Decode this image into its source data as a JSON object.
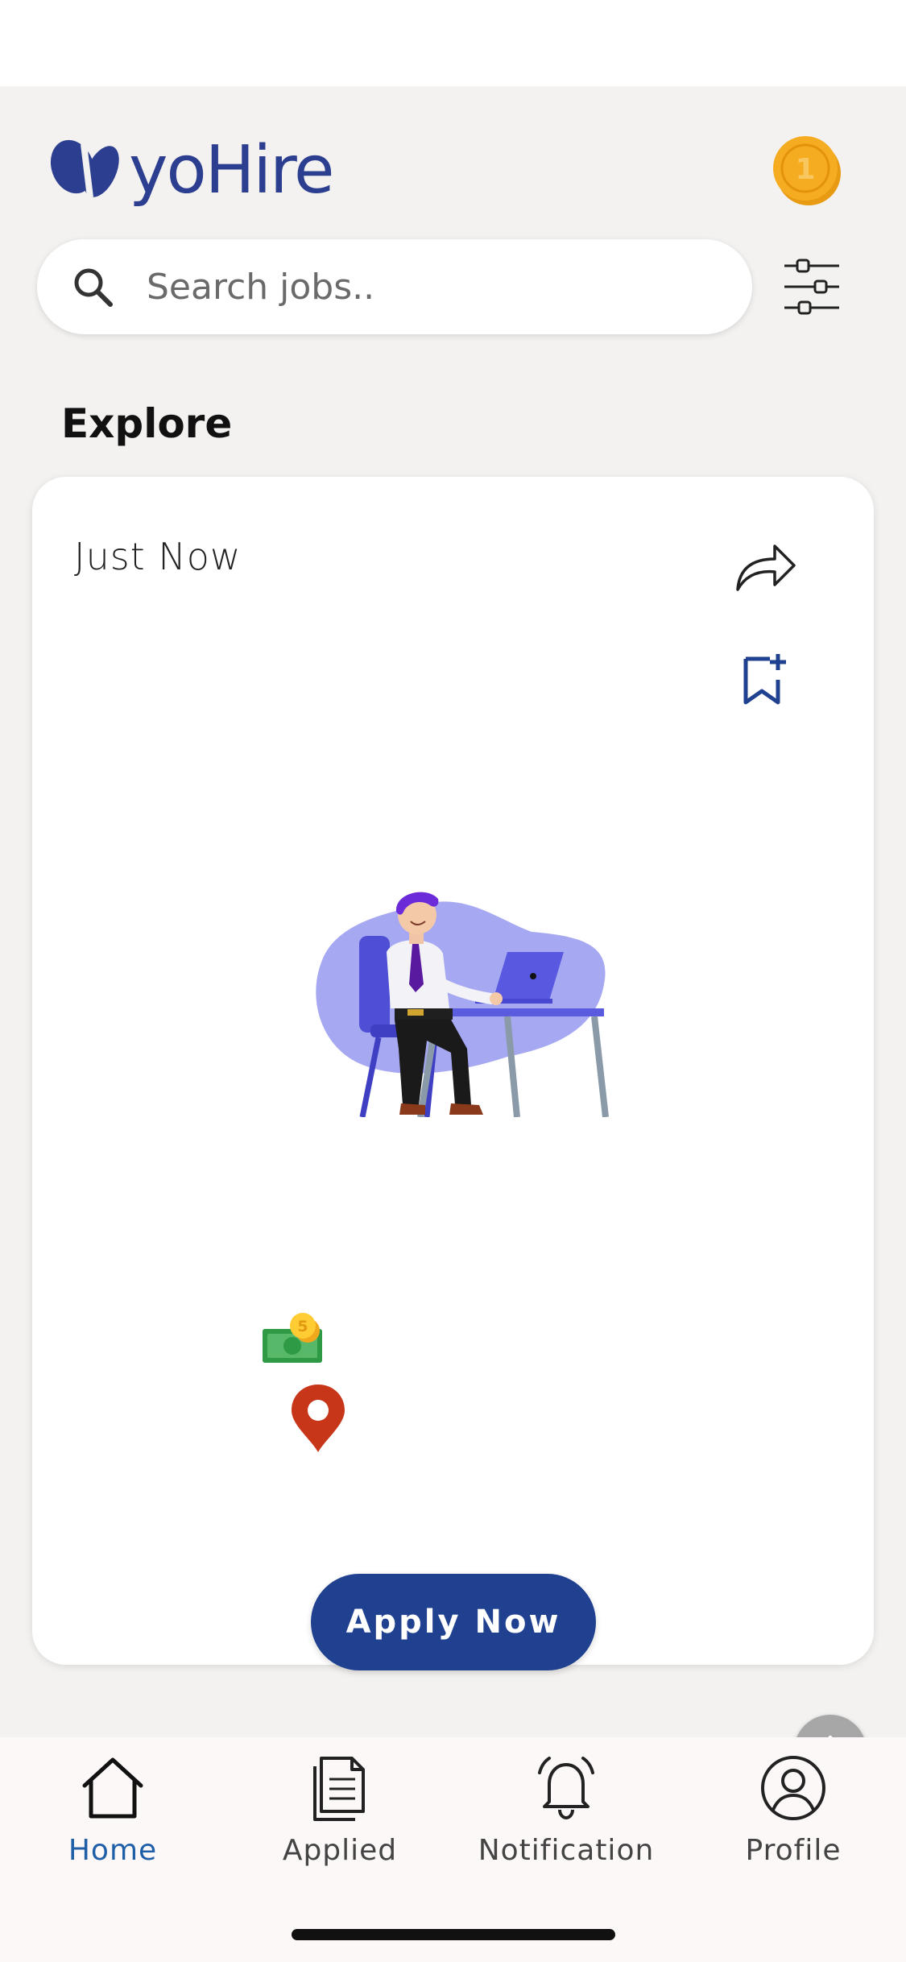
{
  "app": {
    "brand_name": "yoHire",
    "accent_color": "#1f4190",
    "logo_color": "#2c3e8f"
  },
  "header": {
    "logo_icon": "yohire-logo-icon",
    "coin_icon": "coin-icon",
    "coin_value": "1"
  },
  "search": {
    "placeholder": "Search jobs..",
    "icon": "search-icon",
    "filter_icon": "sliders-icon"
  },
  "explore": {
    "title": "Explore"
  },
  "job_card": {
    "time_label": "Just Now",
    "share_icon": "share-icon",
    "bookmark_icon": "bookmark-add-icon",
    "illustration": "office-worker-illustration",
    "salary_icon": "money-icon",
    "salary_coin_value": "5",
    "location_icon": "location-pin-icon",
    "apply_label": "Apply Now"
  },
  "scroll_top": {
    "icon": "arrow-up-icon"
  },
  "bottom_nav": {
    "items": [
      {
        "label": "Home",
        "icon": "home-icon",
        "active": true
      },
      {
        "label": "Applied",
        "icon": "document-icon",
        "active": false
      },
      {
        "label": "Notification",
        "icon": "bell-icon",
        "active": false
      },
      {
        "label": "Profile",
        "icon": "user-icon",
        "active": false
      }
    ],
    "active_color": "#1f5fa8"
  }
}
